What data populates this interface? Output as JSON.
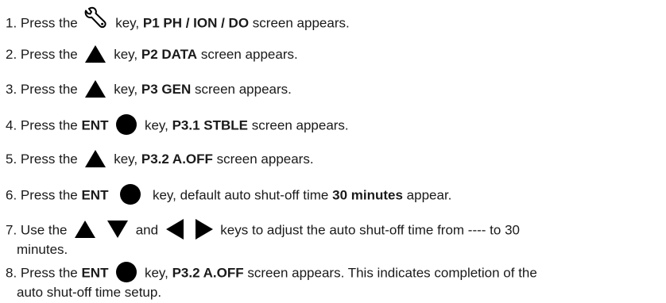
{
  "steps": [
    {
      "n": "1.",
      "a": "Press the",
      "b": "key,",
      "c": "P1 PH / ION / DO",
      "d": "screen appears.",
      "icon": "wrench-icon"
    },
    {
      "n": "2.",
      "a": "Press the",
      "b": "key,",
      "c": "P2 DATA",
      "d": "screen appears.",
      "icon": "up-arrow-icon"
    },
    {
      "n": "3.",
      "a": "Press the",
      "b": "key,",
      "c": "P3 GEN",
      "d": "screen appears.",
      "icon": "up-arrow-icon"
    },
    {
      "n": "4.",
      "a": "Press the",
      "ent": "ENT",
      "b": "key,",
      "c": "P3.1 STBLE",
      "d": "screen appears.",
      "icon": "enter-dot-icon"
    },
    {
      "n": "5.",
      "a": "Press the",
      "b": "key,",
      "c": "P3.2 A.OFF",
      "d": "screen appears.",
      "icon": "up-arrow-icon"
    },
    {
      "n": "6.",
      "a": "Press the",
      "ent": "ENT",
      "b": "key, default auto shut-off time",
      "c": "30 minutes",
      "d": "appear.",
      "icon": "enter-dot-icon"
    },
    {
      "n": "7.",
      "a": "Use the",
      "and": "and",
      "b": "keys to adjust the auto shut-off time from ---- to 30",
      "d": "minutes."
    },
    {
      "n": "8.",
      "a": "Press the",
      "ent": "ENT",
      "b": "key,",
      "c": "P3.2 A.OFF",
      "d": "screen appears. This indicates completion of the",
      "e": "auto shut-off time setup.",
      "icon": "enter-dot-icon"
    }
  ]
}
